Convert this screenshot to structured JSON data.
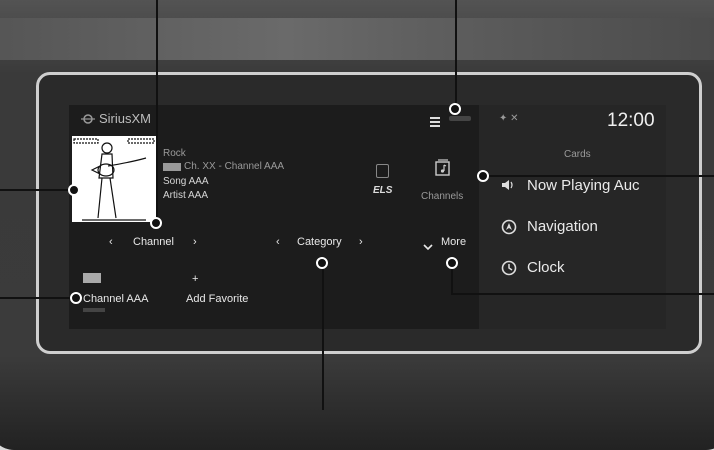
{
  "header": {
    "title": "SiriusXM",
    "time": "12:00"
  },
  "now_playing": {
    "genre": "Rock",
    "channel_line": "Ch. XX - Channel AAA",
    "song": "Song AAA",
    "artist": "Artist AAA",
    "els_label": "ELS"
  },
  "channels_button": {
    "label": "Channels"
  },
  "controls": {
    "channel": "Channel",
    "category": "Category",
    "more": "More"
  },
  "favorites": {
    "channel_name": "Channel AAA",
    "add_label": "Add Favorite",
    "add_symbol": "+"
  },
  "cards": {
    "title": "Cards",
    "items": [
      {
        "label": "Now Playing Auc",
        "icon": "speaker-icon"
      },
      {
        "label": "Navigation",
        "icon": "navigation-icon"
      },
      {
        "label": "Clock",
        "icon": "clock-icon"
      }
    ]
  }
}
